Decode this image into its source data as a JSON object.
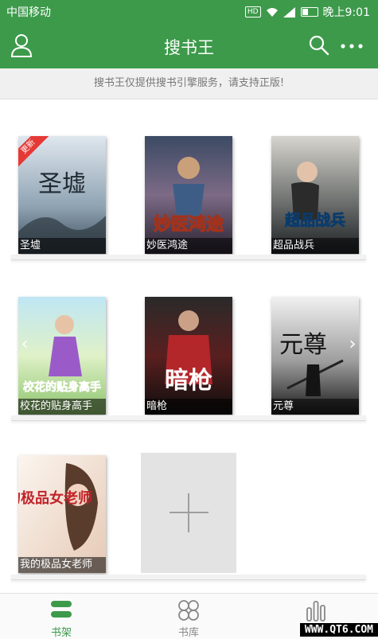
{
  "status_bar": {
    "carrier": "中国移动",
    "network": "HD",
    "time": "晚上9:01"
  },
  "app_bar": {
    "title": "搜书王"
  },
  "notice": "搜书王仅提供搜书引擎服务，请支持正版!",
  "books": [
    {
      "title": "圣墟",
      "badge": "更新",
      "cover_text": "圣墟"
    },
    {
      "title": "妙医鸿途",
      "cover_text": "妙医鸿途"
    },
    {
      "title": "超品战兵",
      "cover_text": "超品战兵"
    },
    {
      "title": "校花的贴身高手",
      "cover_text": "校花的贴身高手"
    },
    {
      "title": "暗枪",
      "cover_text": "暗枪"
    },
    {
      "title": "元尊",
      "cover_text": "元尊"
    },
    {
      "title": "我的极品女老师",
      "cover_text": "我的极品女老师"
    }
  ],
  "bottom_nav": [
    {
      "label": "书架",
      "icon": "bookshelf-icon",
      "active": true
    },
    {
      "label": "书库",
      "icon": "library-icon",
      "active": false
    },
    {
      "label": "",
      "icon": "ranking-icon",
      "active": false
    }
  ],
  "watermark": "WWW.QT6.COM",
  "colors": {
    "primary": "#3d9a4b",
    "badge": "#e53935"
  }
}
